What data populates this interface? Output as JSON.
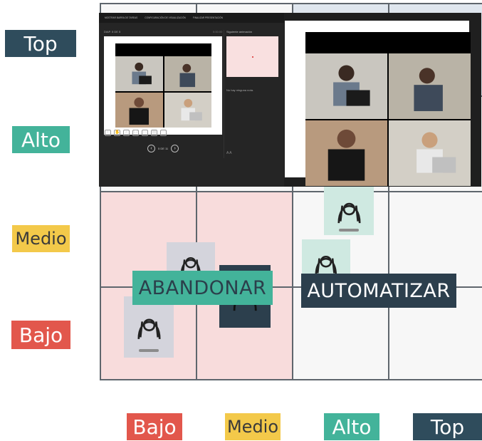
{
  "matrix": {
    "y_labels": [
      "Top",
      "Alto",
      "Medio",
      "Bajo"
    ],
    "x_labels": [
      "Bajo",
      "Medio",
      "Alto",
      "Top"
    ],
    "banners": {
      "abandonar": "ABANDONAR",
      "automatizar": "AUTOMATIZAR"
    },
    "colors": {
      "top": "#2f4c5c",
      "alto": "#43b39a",
      "medio": "#f3c94a",
      "bajo": "#e2574c"
    }
  },
  "presenter": {
    "titlebar": [
      "MOSTRAR BARRA DE TAREAS",
      "CONFIGURACIÓN DE VISUALIZACIÓN",
      "FINALIZAR PRESENTACIÓN"
    ],
    "slide_counter": "DIAP. 5 DE 5",
    "timer": "0:00:00",
    "nav_text": "5 DE 11",
    "next_label": "Siguiente animación",
    "notes": "No hay ninguna nota.",
    "font_controls": "A A"
  }
}
